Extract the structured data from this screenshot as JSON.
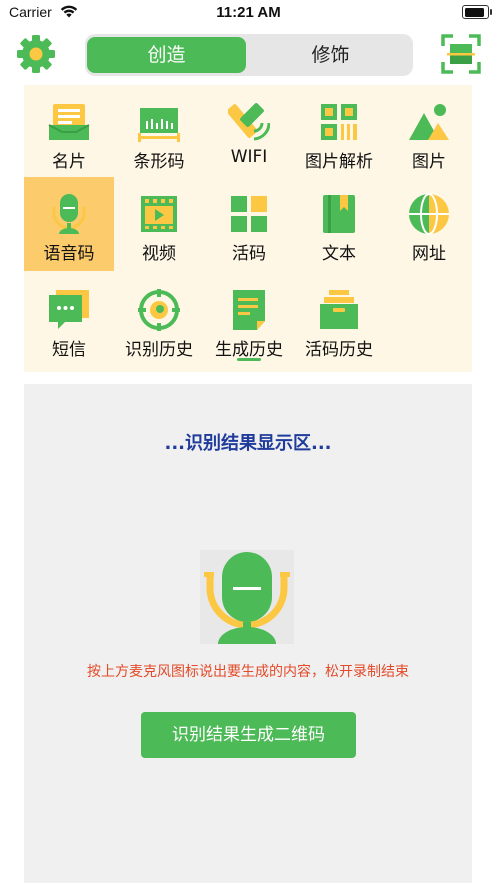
{
  "status_bar": {
    "carrier": "Carrier",
    "time": "11:21 AM"
  },
  "nav": {
    "tabs": [
      {
        "label": "创造",
        "active": true
      },
      {
        "label": "修饰",
        "active": false
      }
    ],
    "settings_icon": "gear-icon",
    "scan_icon": "scan-icon"
  },
  "grid": {
    "items": [
      {
        "label": "名片",
        "icon": "business-card-icon"
      },
      {
        "label": "条形码",
        "icon": "barcode-icon"
      },
      {
        "label": "WIFI",
        "icon": "wifi-icon"
      },
      {
        "label": "图片解析",
        "icon": "image-parse-icon"
      },
      {
        "label": "图片",
        "icon": "image-icon"
      },
      {
        "label": "语音码",
        "icon": "microphone-icon",
        "selected": true
      },
      {
        "label": "视频",
        "icon": "video-icon"
      },
      {
        "label": "活码",
        "icon": "live-code-icon"
      },
      {
        "label": "文本",
        "icon": "text-book-icon"
      },
      {
        "label": "网址",
        "icon": "globe-icon"
      },
      {
        "label": "短信",
        "icon": "message-icon"
      },
      {
        "label": "识别历史",
        "icon": "recognize-history-icon"
      },
      {
        "label": "生成历史",
        "icon": "generate-history-icon"
      },
      {
        "label": "活码历史",
        "icon": "live-code-history-icon"
      }
    ]
  },
  "result": {
    "title": "...识别结果显示区...",
    "hint": "按上方麦克风图标说出要生成的内容，松开录制结束",
    "button_label": "识别结果生成二维码"
  },
  "colors": {
    "green": "#4cba56",
    "yellow": "#fcc843",
    "grid_bg": "#fef7e6",
    "selected_bg": "#fccc6c",
    "title_blue": "#1f3c9c",
    "hint_red": "#e34b2a"
  }
}
